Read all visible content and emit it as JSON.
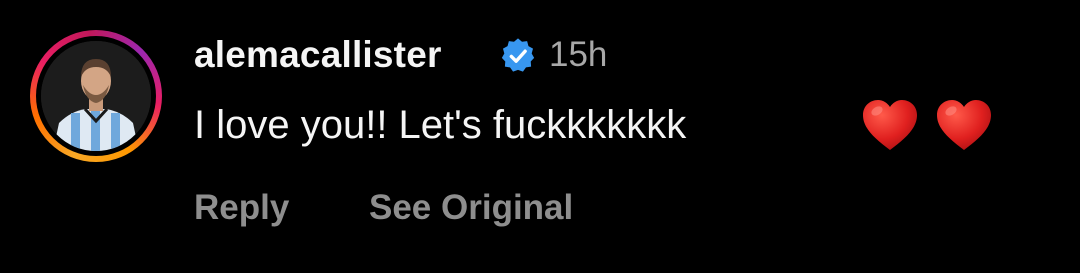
{
  "comment": {
    "username": "alemacallister",
    "verified": true,
    "timestamp": "15h",
    "text": "I love you!! Let's fuckkkkkkk",
    "reactions": [
      "red-heart-emoji",
      "red-heart-emoji"
    ],
    "actions": {
      "reply_label": "Reply",
      "see_original_label": "See Original"
    },
    "avatar": {
      "story_ring": true,
      "ring_colors": [
        "#f9a825",
        "#e91e63",
        "#9c27b0"
      ]
    }
  },
  "colors": {
    "background": "#000000",
    "primary_text": "#f5f5f5",
    "secondary_text": "#a8a8a8",
    "action_text": "#8e8e8e",
    "verified_badge": "#3897f0",
    "heart": "#e0201f"
  }
}
